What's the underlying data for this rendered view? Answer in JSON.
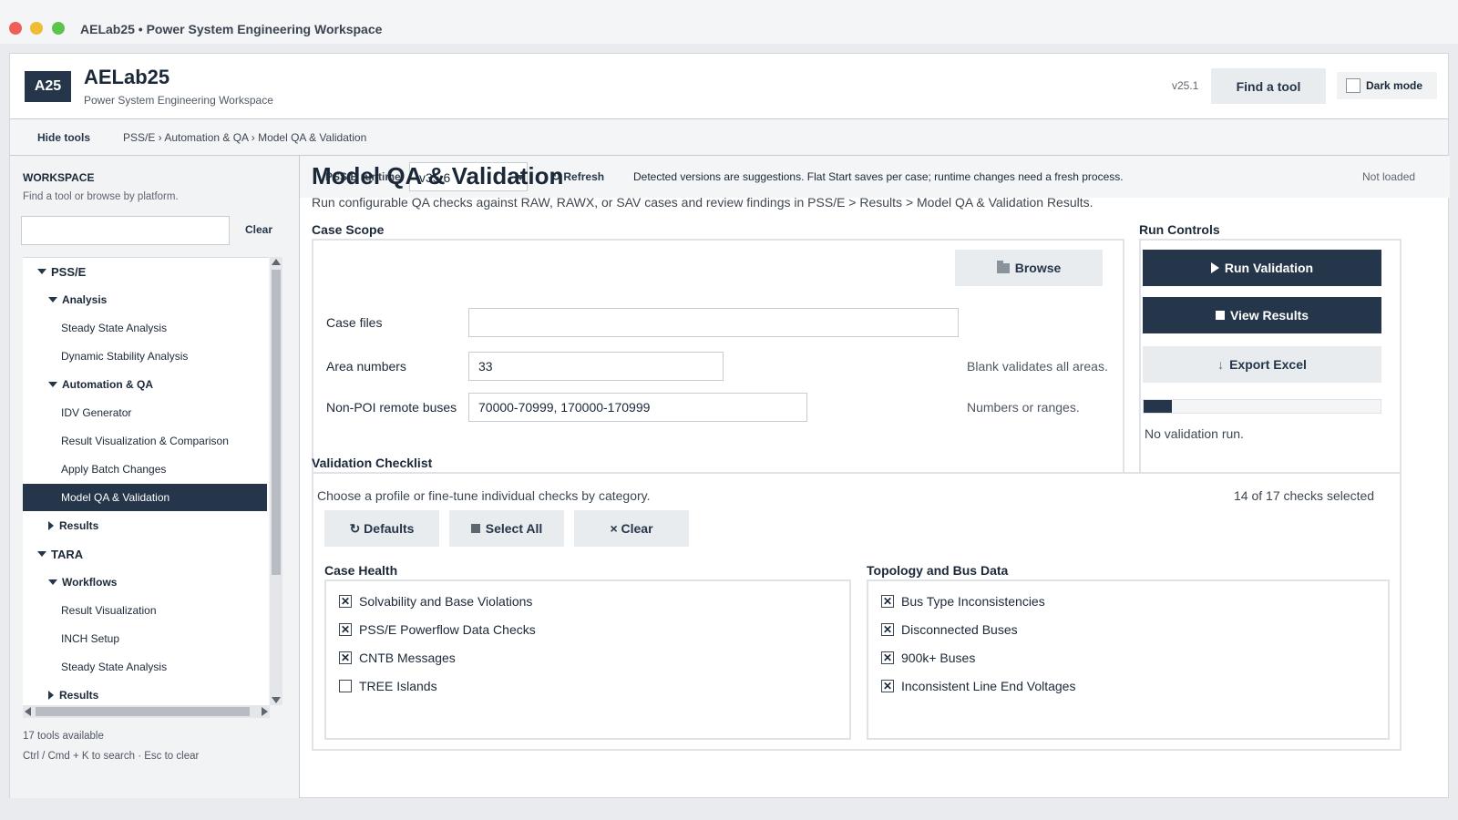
{
  "window": {
    "title": "AELab25 • Power System Engineering Workspace"
  },
  "header": {
    "logo_text": "A25",
    "app_name": "AELab25",
    "app_subtitle": "Power System Engineering Workspace",
    "version": "v25.1",
    "find_tool_label": "Find a tool",
    "dark_mode_label": "Dark mode",
    "dark_mode_checked": false
  },
  "crumbbar": {
    "hide_tools_label": "Hide tools",
    "breadcrumb": "PSS/E › Automation & QA › Model QA & Validation"
  },
  "sidebar": {
    "title": "WORKSPACE",
    "subtitle": "Find a tool or browse by platform.",
    "search_value": "",
    "clear_label": "Clear",
    "tree": [
      {
        "label": "PSS/E",
        "level": 0,
        "expanded": true
      },
      {
        "label": "Analysis",
        "level": 1,
        "expanded": true
      },
      {
        "label": "Steady State Analysis",
        "level": 2
      },
      {
        "label": "Dynamic Stability Analysis",
        "level": 2
      },
      {
        "label": "Automation & QA",
        "level": 1,
        "expanded": true
      },
      {
        "label": "IDV Generator",
        "level": 2
      },
      {
        "label": "Result Visualization & Comparison",
        "level": 2
      },
      {
        "label": "Apply Batch Changes",
        "level": 2
      },
      {
        "label": "Model QA & Validation",
        "level": 2,
        "active": true
      },
      {
        "label": "Results",
        "level": 1,
        "expanded": false
      },
      {
        "label": "TARA",
        "level": 0,
        "expanded": true
      },
      {
        "label": "Workflows",
        "level": 1,
        "expanded": true
      },
      {
        "label": "Result Visualization",
        "level": 2
      },
      {
        "label": "INCH Setup",
        "level": 2
      },
      {
        "label": "Steady State Analysis",
        "level": 2
      },
      {
        "label": "Results",
        "level": 1,
        "expanded": false
      }
    ],
    "tools_count": "17 tools available",
    "shortcut_hint": "Ctrl / Cmd + K to search · Esc to clear"
  },
  "runtime": {
    "label": "PSS/E runtime",
    "selected_version": "v35.6",
    "refresh_label": "↻ Refresh",
    "note": "Detected versions are suggestions. Flat Start saves per case; runtime changes need a fresh process.",
    "status": "Not loaded"
  },
  "page": {
    "title": "Model QA & Validation",
    "description": "Run configurable QA checks against RAW, RAWX, or SAV cases and review findings in PSS/E > Results > Model QA & Validation Results."
  },
  "case_scope": {
    "title": "Case Scope",
    "case_files_label": "Case files",
    "case_files_value": "",
    "browse_label": "Browse",
    "area_label": "Area numbers",
    "area_value": "33",
    "area_hint": "Blank validates all areas.",
    "buses_label": "Non-POI remote buses",
    "buses_value": "70000-70999, 170000-170999",
    "buses_hint": "Numbers or ranges."
  },
  "run_controls": {
    "title": "Run Controls",
    "run_label": "Run Validation",
    "view_label": "View Results",
    "export_label": "Export Excel",
    "progress_fraction": 0.12,
    "status": "No validation run."
  },
  "checklist": {
    "title": "Validation Checklist",
    "subtitle": "Choose a profile or fine-tune individual checks by category.",
    "count_text": "14 of 17 checks selected",
    "defaults_label": "↻ Defaults",
    "select_all_label": "Select All",
    "clear_label": "× Clear",
    "categories": [
      {
        "title": "Case Health",
        "items": [
          {
            "label": "Solvability and Base Violations",
            "checked": true
          },
          {
            "label": "PSS/E Powerflow Data Checks",
            "checked": true
          },
          {
            "label": "CNTB Messages",
            "checked": true
          },
          {
            "label": "TREE Islands",
            "checked": false
          }
        ]
      },
      {
        "title": "Topology and Bus Data",
        "items": [
          {
            "label": "Bus Type Inconsistencies",
            "checked": true
          },
          {
            "label": "Disconnected Buses",
            "checked": true
          },
          {
            "label": "900k+ Buses",
            "checked": true
          },
          {
            "label": "Inconsistent Line End Voltages",
            "checked": true
          }
        ]
      }
    ]
  },
  "colors": {
    "primary": "#25364a",
    "background": "#e9ebee",
    "panel_border": "#dfe2e6"
  }
}
